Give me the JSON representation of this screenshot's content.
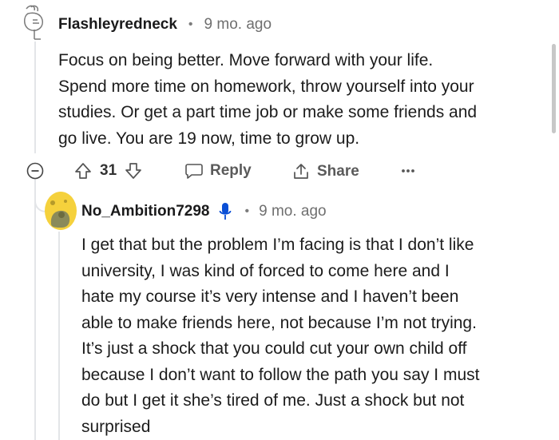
{
  "comment_1": {
    "username": "Flashleyredneck",
    "separator": "•",
    "time": "9 mo. ago",
    "lines": [
      "Focus on being better. Move forward with your life.",
      "Spend more time on homework, throw yourself into your",
      "studies. Or get a part time job or make some friends and",
      "go live. You are 19 now, time to grow up."
    ],
    "actions": {
      "votes": "31",
      "reply_label": "Reply",
      "share_label": "Share"
    }
  },
  "comment_2": {
    "username": "No_Ambition7298",
    "separator": "•",
    "time": "9 mo. ago",
    "lines": [
      "I get that but the problem I’m facing is that I don’t like",
      "university, I was kind of forced to come here and I",
      "hate my course it’s very intense and I haven’t been",
      "able to make friends here, not because I’m not trying.",
      "It’s just a shock that you could cut your own child off",
      "because I don’t want to follow the path you say I must",
      "do but I get it she’s tired of me. Just a shock but not",
      "surprised"
    ]
  },
  "colors": {
    "avatar_yellow": "#f5d13c",
    "mic_blue": "#0a4fd6",
    "thread_line": "#e3e5e8"
  },
  "icons": [
    "avatar-sketch-icon",
    "collapse-icon",
    "upvote-icon",
    "downvote-icon",
    "reply-bubble-icon",
    "share-icon",
    "more-icon",
    "avatar-snoo-icon",
    "microphone-icon"
  ]
}
